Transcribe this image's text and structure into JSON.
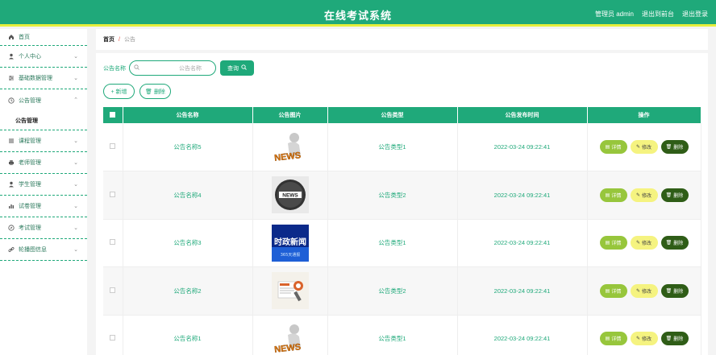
{
  "header": {
    "title": "在线考试系统",
    "user_label": "管理员 admin",
    "back_label": "退出到前台",
    "logout_label": "退出登录"
  },
  "sidebar": {
    "items": [
      {
        "label": "首页",
        "icon": "home-icon"
      },
      {
        "label": "个人中心",
        "icon": "user-icon"
      },
      {
        "label": "基础数据管理",
        "icon": "sliders-icon"
      },
      {
        "label": "公告管理",
        "icon": "clock-icon"
      },
      {
        "label": "课程管理",
        "icon": "list-icon"
      },
      {
        "label": "老师管理",
        "icon": "print-icon"
      },
      {
        "label": "学生管理",
        "icon": "user-icon"
      },
      {
        "label": "试卷管理",
        "icon": "bar-chart-icon"
      },
      {
        "label": "考试管理",
        "icon": "compass-icon"
      },
      {
        "label": "轮播图信息",
        "icon": "link-icon"
      }
    ],
    "submenu_label": "公告管理"
  },
  "breadcrumb": {
    "home": "首页",
    "separator": "/",
    "current": "公告"
  },
  "search": {
    "label": "公告名称",
    "placeholder": "公告名称",
    "button": "查询"
  },
  "actions": {
    "add": "+ 新增",
    "delete": "删除"
  },
  "table": {
    "headers": [
      "公告名称",
      "公告图片",
      "公告类型",
      "公告发布时间",
      "操作"
    ],
    "rows": [
      {
        "name": "公告名称5",
        "image": "news-figure",
        "type": "公告类型1",
        "time": "2022-03-24 09:22:41"
      },
      {
        "name": "公告名称4",
        "image": "news-globe",
        "type": "公告类型2",
        "time": "2022-03-24 09:22:41"
      },
      {
        "name": "公告名称3",
        "image": "news-blue",
        "type": "公告类型1",
        "time": "2022-03-24 09:22:41"
      },
      {
        "name": "公告名称2",
        "image": "news-paper",
        "type": "公告类型2",
        "time": "2022-03-24 09:22:41"
      },
      {
        "name": "公告名称1",
        "image": "news-figure",
        "type": "公告类型1",
        "time": "2022-03-24 09:22:41"
      }
    ],
    "row_actions": {
      "detail": "详情",
      "edit": "修改",
      "delete": "删除"
    }
  },
  "images": {
    "blue_news_text": "时政新闻",
    "blue_news_sub": "365天通报",
    "news_word": "NEWS"
  }
}
